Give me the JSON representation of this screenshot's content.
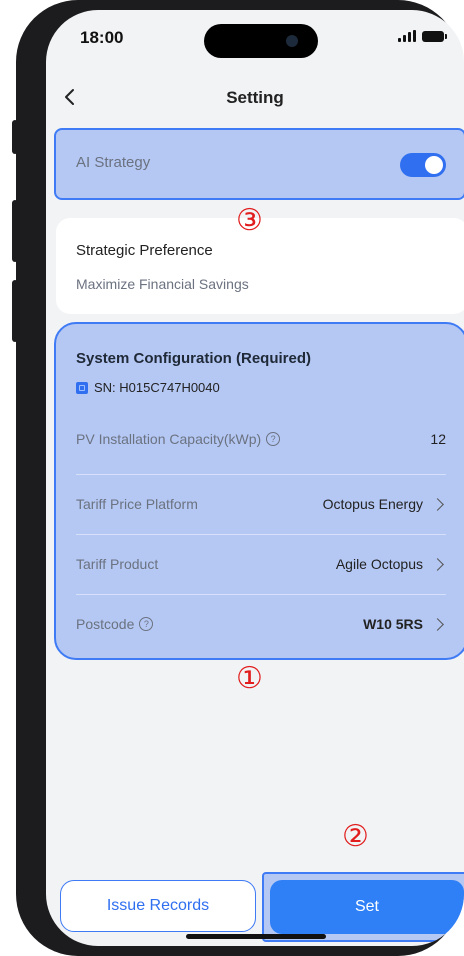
{
  "status_bar": {
    "time": "18:00"
  },
  "header": {
    "title": "Setting"
  },
  "ai_strategy": {
    "label": "AI Strategy",
    "enabled": true
  },
  "preference": {
    "title": "Strategic Preference",
    "value": "Maximize Financial Savings"
  },
  "system_config": {
    "title": "System Configuration (Required)",
    "sn": "SN: H015C747H0040",
    "rows": [
      {
        "label": "PV Installation Capacity(kWp)",
        "value": "12"
      },
      {
        "label": "Tariff Price Platform",
        "value": "Octopus Energy"
      },
      {
        "label": "Tariff Product",
        "value": "Agile Octopus"
      },
      {
        "label": "Postcode",
        "value": "W10 5RS"
      }
    ]
  },
  "buttons": {
    "issue_records": "Issue Records",
    "set": "Set"
  },
  "markers": {
    "one": "①",
    "two": "②",
    "three": "③"
  },
  "colors": {
    "accent": "#2f6ff0",
    "highlight": "#b5c8f4",
    "marker": "#e11d1d"
  }
}
